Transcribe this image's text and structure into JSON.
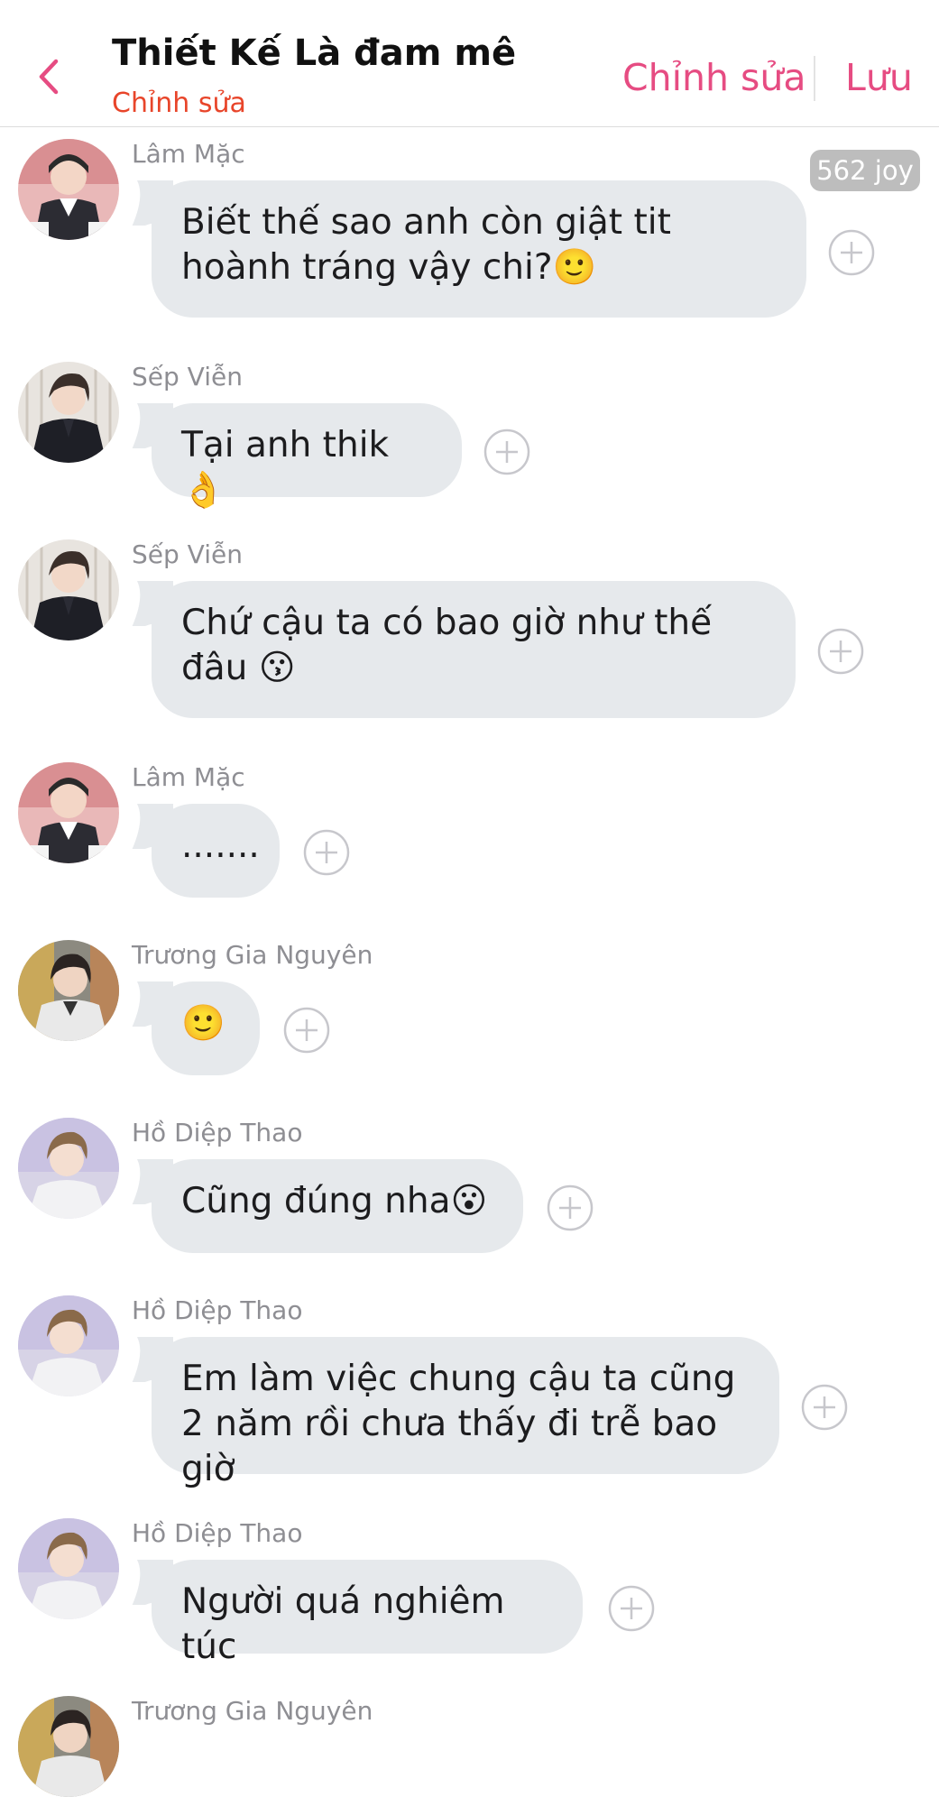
{
  "header": {
    "title": "Thiết Kế Là đam mê",
    "subtitle": "Chỉnh sửa",
    "edit_label": "Chỉnh sửa",
    "save_label": "Lưu",
    "accent_color": "#e64c82"
  },
  "joy_badge": "562 joy",
  "messages": [
    {
      "sender": "Lâm Mặc",
      "text": "Biết thế sao anh còn giật tit  hoành tráng vậy chi?🙂",
      "avatar": "avatar-lam-mac"
    },
    {
      "sender": "Sếp Viễn",
      "text": "Tại anh thik 👌",
      "avatar": "avatar-sep-vien"
    },
    {
      "sender": "Sếp Viễn",
      "text": "Chứ cậu ta có bao giờ như thế đâu 😗",
      "avatar": "avatar-sep-vien"
    },
    {
      "sender": "Lâm Mặc",
      "text": ".......",
      "avatar": "avatar-lam-mac"
    },
    {
      "sender": "Trương Gia Nguyên",
      "text": "🙂",
      "avatar": "avatar-truong-gia-nguyen"
    },
    {
      "sender": "Hồ Diệp Thao",
      "text": "Cũng đúng nha😮",
      "avatar": "avatar-ho-diep-thao"
    },
    {
      "sender": "Hồ Diệp Thao",
      "text": "Em làm việc chung cậu ta cũng 2 năm rồi chưa thấy đi trễ bao giờ",
      "avatar": "avatar-ho-diep-thao"
    },
    {
      "sender": "Hồ Diệp Thao",
      "text": "Người quá nghiêm túc",
      "avatar": "avatar-ho-diep-thao"
    },
    {
      "sender": "Trương Gia Nguyên",
      "text": "",
      "avatar": "avatar-truong-gia-nguyen"
    }
  ]
}
